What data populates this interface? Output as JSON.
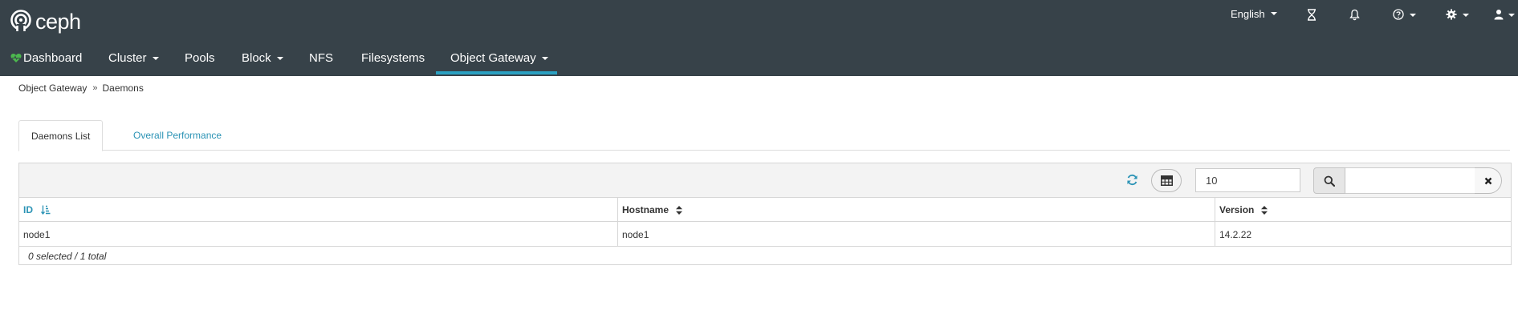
{
  "app": {
    "logo_text": "ceph"
  },
  "utility": {
    "language": "English"
  },
  "nav": {
    "items": [
      {
        "label": "Dashboard"
      },
      {
        "label": "Cluster"
      },
      {
        "label": "Pools"
      },
      {
        "label": "Block"
      },
      {
        "label": "NFS"
      },
      {
        "label": "Filesystems"
      },
      {
        "label": "Object Gateway"
      }
    ],
    "active": "Object Gateway"
  },
  "breadcrumb": {
    "items": [
      "Object Gateway",
      "Daemons"
    ],
    "separator": "»"
  },
  "tabs": [
    {
      "label": "Daemons List",
      "active": true
    },
    {
      "label": "Overall Performance",
      "active": false
    }
  ],
  "table": {
    "page_size": "10",
    "search_value": "",
    "columns": [
      "ID",
      "Hostname",
      "Version"
    ],
    "rows": [
      {
        "id": "node1",
        "hostname": "node1",
        "version": "14.2.22"
      }
    ],
    "footer": "0 selected / 1 total"
  },
  "colors": {
    "header_bg": "#374249",
    "accent": "#2ba1c2",
    "link": "#2b93b5",
    "heart": "#4cb84e",
    "refresh": "#2b93b5"
  },
  "icons": [
    "ceph-logo-icon",
    "hourglass-icon",
    "bell-icon",
    "help-icon",
    "gear-icon",
    "user-icon",
    "heart-pulse-icon",
    "refresh-icon",
    "table-columns-icon",
    "search-icon",
    "close-icon",
    "sort-amount-icon",
    "sort-icon"
  ]
}
